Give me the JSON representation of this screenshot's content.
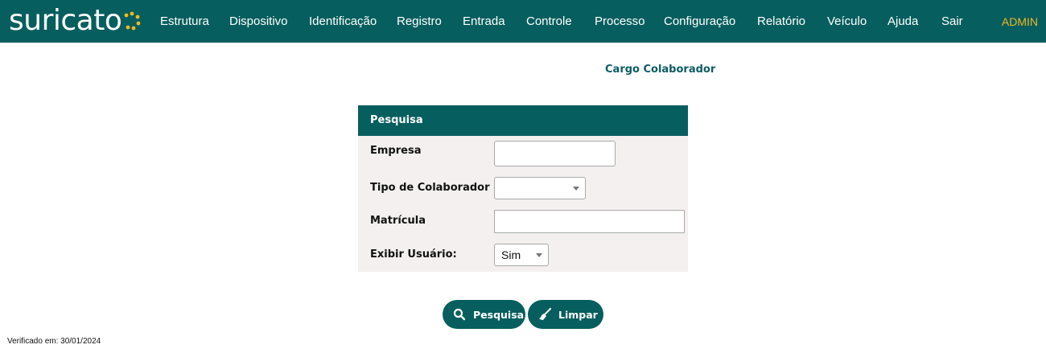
{
  "app": {
    "logo_text": "suricato",
    "brand_color": "#075e5e",
    "accent_color": "#f0b820"
  },
  "nav": {
    "items": [
      {
        "label": "Estrutura"
      },
      {
        "label": "Dispositivo"
      },
      {
        "label": "Identificação"
      },
      {
        "label": "Registro"
      },
      {
        "label": "Entrada"
      },
      {
        "label": "Controle"
      },
      {
        "label": "Processo"
      },
      {
        "label": "Configuração"
      },
      {
        "label": "Relatório"
      },
      {
        "label": "Veículo"
      },
      {
        "label": "Ajuda"
      },
      {
        "label": "Sair"
      }
    ],
    "user": "ADMIN"
  },
  "page": {
    "title": "Cargo Colaborador"
  },
  "search_panel": {
    "header": "Pesquisa",
    "fields": {
      "empresa": {
        "label": "Empresa",
        "value": ""
      },
      "tipo_colaborador": {
        "label": "Tipo de Colaborador",
        "value": ""
      },
      "matricula": {
        "label": "Matrícula",
        "value": ""
      },
      "exibir_usuario": {
        "label": "Exibir Usuário:",
        "value": "Sim"
      }
    }
  },
  "actions": {
    "search_label": "Pesquisa",
    "clear_label": "Limpar"
  },
  "footer": {
    "verified": "Verificado em: 30/01/2024"
  }
}
